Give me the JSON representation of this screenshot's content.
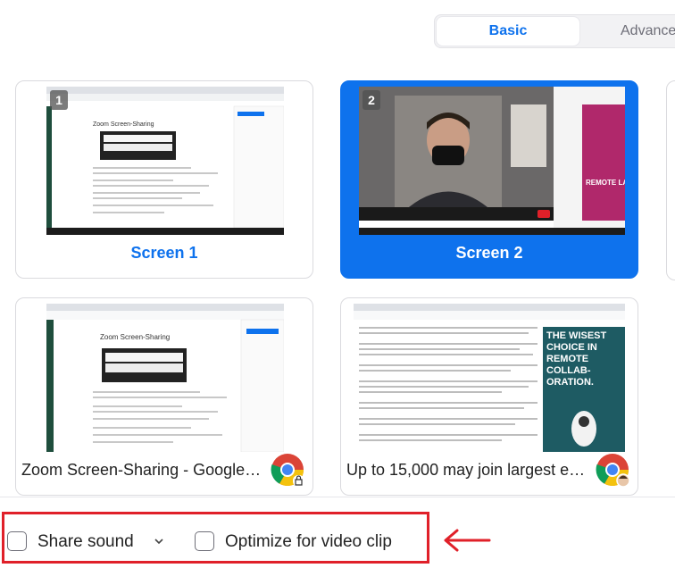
{
  "tabs": {
    "basic": "Basic",
    "advanced": "Advance"
  },
  "screens": [
    {
      "badge": "1",
      "label": "Screen 1",
      "selected": false
    },
    {
      "badge": "2",
      "label": "Screen 2",
      "selected": true
    }
  ],
  "windows": [
    {
      "title": "Zoom Screen-Sharing - Google C...",
      "doc_heading": "Zoom Screen-Sharing"
    },
    {
      "title": "Up to 15,000 may join largest ev...",
      "ad_text": "THE WISEST CHOICE IN REMOTE COLLAB- ORATION."
    }
  ],
  "screen1_doc_heading": "Zoom Screen-Sharing",
  "screen2_ad_text": "REMOTE LAB- ON.",
  "options": {
    "share_sound": "Share sound",
    "optimize": "Optimize for video clip"
  },
  "colors": {
    "accent": "#0e72ed",
    "highlight": "#e02029"
  }
}
